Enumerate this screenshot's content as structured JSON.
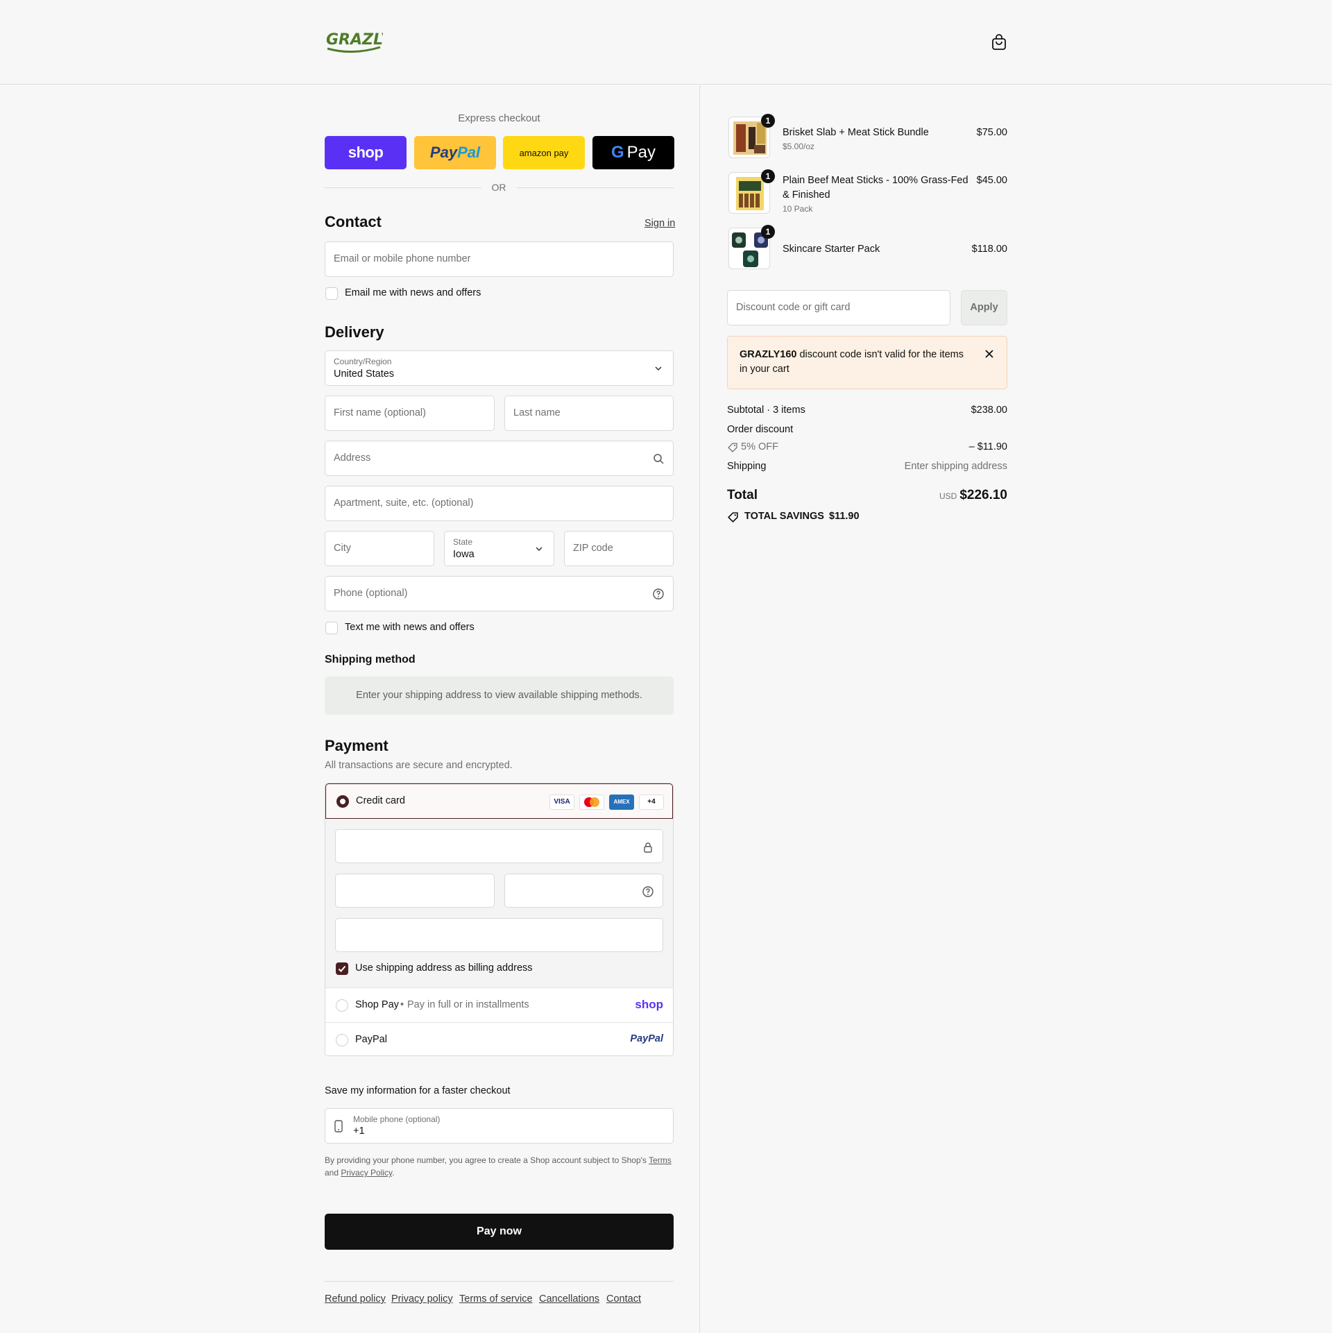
{
  "header": {
    "logo_text": "GRAZLY",
    "cart_icon": "shopping-bag-icon"
  },
  "express": {
    "label": "Express checkout",
    "buttons": {
      "shop": "shop",
      "paypal": "PayPal",
      "amazon": "amazon pay",
      "gpay": "Pay"
    },
    "or": "OR"
  },
  "contact": {
    "title": "Contact",
    "sign_in": "Sign in",
    "email_placeholder": "Email or mobile phone number",
    "news_checkbox": "Email me with news and offers"
  },
  "delivery": {
    "title": "Delivery",
    "country_label": "Country/Region",
    "country_value": "United States",
    "first_name": "First name (optional)",
    "last_name": "Last name",
    "address": "Address",
    "apartment": "Apartment, suite, etc. (optional)",
    "city": "City",
    "state_label": "State",
    "state_value": "Iowa",
    "zip": "ZIP code",
    "phone": "Phone (optional)",
    "text_checkbox": "Text me with news and offers"
  },
  "shipping_method": {
    "title": "Shipping method",
    "message": "Enter your shipping address to view available shipping methods."
  },
  "payment": {
    "title": "Payment",
    "subtitle": "All transactions are secure and encrypted.",
    "credit_card": "Credit card",
    "card_brands": [
      "VISA",
      "MC",
      "AMEX",
      "+4"
    ],
    "billing_checkbox": "Use shipping address as billing address",
    "shop_pay": "Shop Pay",
    "shop_pay_sub": "Pay in full or in installments",
    "shop_pay_logo": "shop",
    "paypal": "PayPal",
    "paypal_logo": "PayPal"
  },
  "save_info": {
    "title": "Save my information for a faster checkout",
    "mobile_label": "Mobile phone (optional)",
    "mobile_value": "+1",
    "disclaimer_pre": "By providing your phone number, you agree to create a Shop account subject to Shop's ",
    "terms": "Terms",
    "and": "and ",
    "privacy": "Privacy Policy",
    "period": "."
  },
  "pay_now": "Pay now",
  "footer_links": [
    "Refund policy",
    "Privacy policy",
    "Terms of service",
    "Cancellations",
    "Contact"
  ],
  "order": {
    "items": [
      {
        "name": "Brisket Slab + Meat Stick Bundle",
        "sub": "$5.00/oz",
        "price": "$75.00",
        "qty": "1"
      },
      {
        "name": "Plain Beef Meat Sticks - 100% Grass-Fed & Finished",
        "sub": "10 Pack",
        "price": "$45.00",
        "qty": "1"
      },
      {
        "name": "Skincare Starter Pack",
        "sub": "",
        "price": "$118.00",
        "qty": "1"
      }
    ],
    "discount_placeholder": "Discount code or gift card",
    "apply": "Apply",
    "warning_code": "GRAZLY160",
    "warning_text": " discount code isn't valid for the items in your cart",
    "subtotal_label": "Subtotal · 3 items",
    "subtotal_value": "$238.00",
    "order_discount_label": "Order discount",
    "discount_tag": "5% OFF",
    "discount_value": "– $11.90",
    "shipping_label": "Shipping",
    "shipping_value": "Enter shipping address",
    "total_label": "Total",
    "total_currency": "USD",
    "total_value": "$226.10",
    "savings_label": "TOTAL SAVINGS",
    "savings_value": "$11.90"
  },
  "colors": {
    "accent": "#4a1f24",
    "shop_purple": "#5a31f4",
    "paypal_yellow": "#ffc439",
    "amazon_yellow": "#ffd814",
    "logo_green": "#4f7c2a"
  }
}
